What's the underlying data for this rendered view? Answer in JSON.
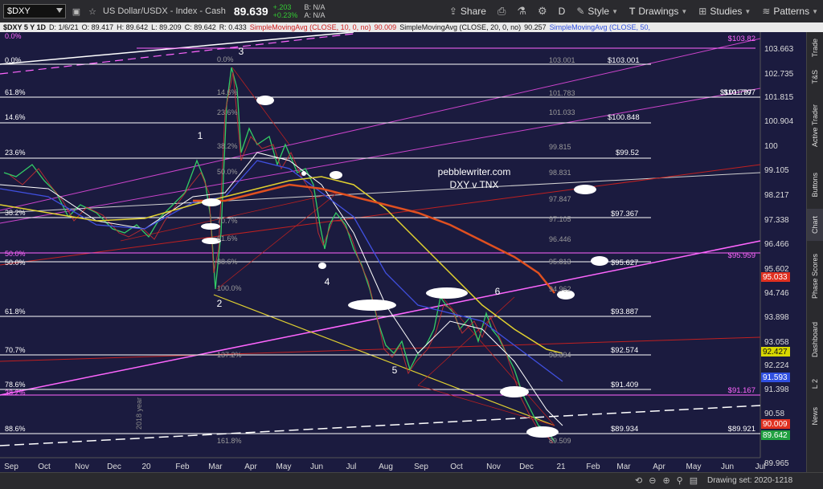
{
  "toolbar": {
    "symbol": "$DXY",
    "description": "US Dollar/USDX - Index - Cash",
    "price": "89.639",
    "change": "+.203",
    "change_pct": "+0.23%",
    "bid": "B: N/A",
    "ask": "A: N/A",
    "period": "D",
    "share_label": "Share",
    "style_label": "Style",
    "drawings_label": "Drawings",
    "studies_label": "Studies",
    "patterns_label": "Patterns"
  },
  "infobar": {
    "symbol_period": "$DXY 5 Y 1D",
    "date": "D: 1/6/21",
    "open": "O: 89.417",
    "high": "H: 89.642",
    "low": "L: 89.209",
    "close": "C: 89.642",
    "range": "R: 0.433",
    "sma10": "SimpleMovingAvg (CLOSE, 10, 0, no)",
    "sma10_val": "90.009",
    "sma20": "SimpleMovingAvg (CLOSE, 20, 0, no)",
    "sma20_val": "90.257",
    "sma50": "SimpleMovingAvg (CLOSE, 50,"
  },
  "chart": {
    "watermark_line1": "pebblewriter.com",
    "watermark_line2": "DXY v TNX",
    "year_label": "2018 year",
    "wave_labels": [
      "1",
      "2",
      "3",
      "4",
      "5",
      "6"
    ],
    "price_axis": [
      "103.663",
      "102.735",
      "101.815",
      "100.904",
      "100",
      "99.105",
      "98.217",
      "97.338",
      "96.466",
      "95.602",
      "94.746",
      "93.898",
      "93.058",
      "92.224",
      "91.398",
      "90.58",
      "89.965"
    ],
    "x_axis": [
      "Sep",
      "Oct",
      "Nov",
      "Dec",
      "20",
      "Feb",
      "Mar",
      "Apr",
      "May",
      "Jun",
      "Jul",
      "Aug",
      "Sep",
      "Oct",
      "Nov",
      "Dec",
      "21",
      "Feb",
      "Mar",
      "Apr",
      "May",
      "Jun",
      "Jul"
    ],
    "left_fib": [
      {
        "label": "0.0%",
        "color": "#ff66ff"
      },
      {
        "label": "0.0%",
        "color": "#ffffff"
      },
      {
        "label": "61.8%",
        "color": "#ffffff"
      },
      {
        "label": "14.6%",
        "color": "#ffffff"
      },
      {
        "label": "23.6%",
        "color": "#ffffff"
      },
      {
        "label": "38.2%",
        "color": "#ffffff"
      },
      {
        "label": "50.0%",
        "color": "#ff66ff"
      },
      {
        "label": "50.0%",
        "color": "#ffffff"
      },
      {
        "label": "61.8%",
        "color": "#ffffff"
      },
      {
        "label": "70.7%",
        "color": "#ffffff"
      },
      {
        "label": "78.6%",
        "color": "#ffffff"
      },
      {
        "label": "38.2%",
        "color": "#ff66ff"
      },
      {
        "label": "88.6%",
        "color": "#ffffff"
      }
    ],
    "inner_fib": [
      "0.0%",
      "14.6%",
      "23.6%",
      "38.2%",
      "50.0%",
      "70.7%",
      "61.6%",
      "88.6%",
      "100.0%",
      "137.2%",
      "161.8%"
    ],
    "mid_values": [
      "103.001",
      "101.783",
      "101.033",
      "99.815",
      "98.831",
      "97.847",
      "97.105",
      "96.446",
      "95.813",
      "94.962",
      "93.394",
      "89.509"
    ],
    "right_values": [
      {
        "label": "$103.001",
        "color": "#ffffff"
      },
      {
        "label": "$101.797",
        "color": "#ffffff"
      },
      {
        "label": "$100.848",
        "color": "#ffffff"
      },
      {
        "label": "$99.52",
        "color": "#ffffff"
      },
      {
        "label": "$97.367",
        "color": "#ffffff"
      },
      {
        "label": "$95.627",
        "color": "#ffffff"
      },
      {
        "label": "$93.887",
        "color": "#ffffff"
      },
      {
        "label": "$92.574",
        "color": "#ffffff"
      },
      {
        "label": "$91.409",
        "color": "#ffffff"
      },
      {
        "label": "$89.934",
        "color": "#ffffff"
      }
    ],
    "far_right_values": [
      {
        "label": "$103.82",
        "color": "#ff66ff"
      },
      {
        "label": "$101.797",
        "color": "#ffffff"
      },
      {
        "label": "$95.959",
        "color": "#ff66ff"
      },
      {
        "label": "$91.167",
        "color": "#ff66ff"
      },
      {
        "label": "$89.921",
        "color": "#ffffff"
      }
    ],
    "axis_badges": [
      {
        "label": "95.033",
        "color": "#e03020"
      },
      {
        "label": "92.427",
        "color": "#d8d800"
      },
      {
        "label": "91.593",
        "color": "#3050e0"
      },
      {
        "label": "90.009",
        "color": "#e03020"
      },
      {
        "label": "89.642",
        "color": "#20a040"
      }
    ]
  },
  "sidebar": [
    "Trade",
    "T&S",
    "Active Trader",
    "Buttons",
    "Chart",
    "Phase Scores",
    "Dashboard",
    "L 2",
    "News"
  ],
  "bottom": {
    "drawing_set": "Drawing set: 2020-1218"
  }
}
